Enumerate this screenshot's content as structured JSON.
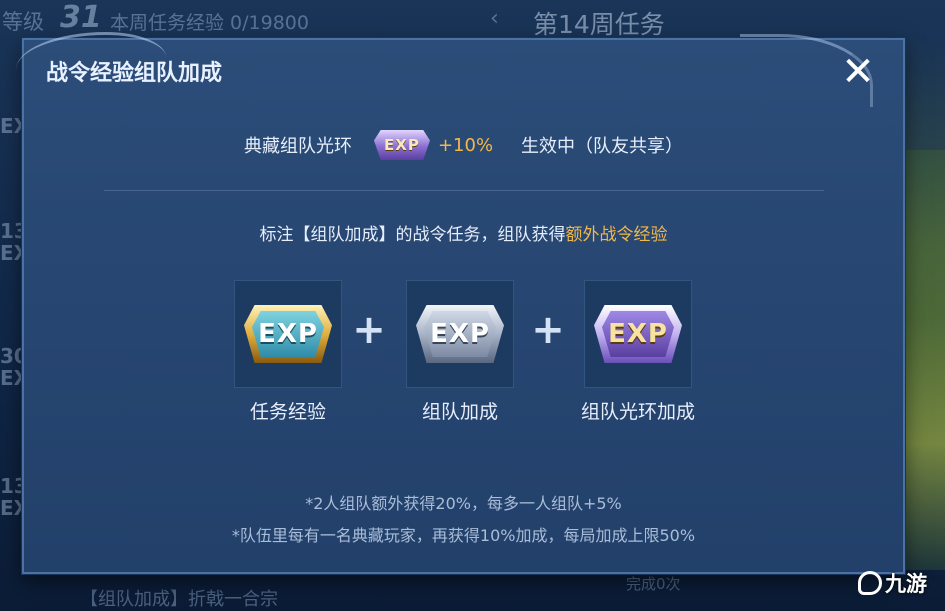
{
  "background": {
    "level_label": "等级",
    "level_value": "31",
    "weekly_exp": "本周任务经验 0/19800",
    "back_glyph": "‹",
    "week_title": "第14周任务",
    "side_labels": [
      "EX",
      "13\nEX",
      "30\nEX",
      "13\nEX"
    ],
    "bottom_tag": "【组队加成】折戟一合宗",
    "bottom_done": "完成0次"
  },
  "watermark": {
    "text": "九游"
  },
  "dialog": {
    "title": "战令经验组队加成",
    "close_icon": "close-icon",
    "aura": {
      "label": "典藏组队光环",
      "badge_text": "EXP",
      "bonus": "+10%",
      "status": "生效中（队友共享）"
    },
    "description": {
      "prefix": "标注【组队加成】的战令任务，组队获得",
      "highlight": "额外战令经验"
    },
    "cards": [
      {
        "badge": "EXP",
        "label": "任务经验",
        "icon": "exp-gold-icon"
      },
      {
        "badge": "EXP",
        "label": "组队加成",
        "icon": "exp-silver-icon"
      },
      {
        "badge": "EXP",
        "label": "组队光环加成",
        "icon": "exp-purple-icon"
      }
    ],
    "plus": "+",
    "notes": [
      "*2人组队额外获得20%，每多一人组队+5%",
      "*队伍里每有一名典藏玩家，再获得10%加成，每局加成上限50%"
    ]
  },
  "colors": {
    "highlight": "#f1b84a",
    "dialog_bg": "#2c4d79",
    "text": "#e6eefb"
  }
}
